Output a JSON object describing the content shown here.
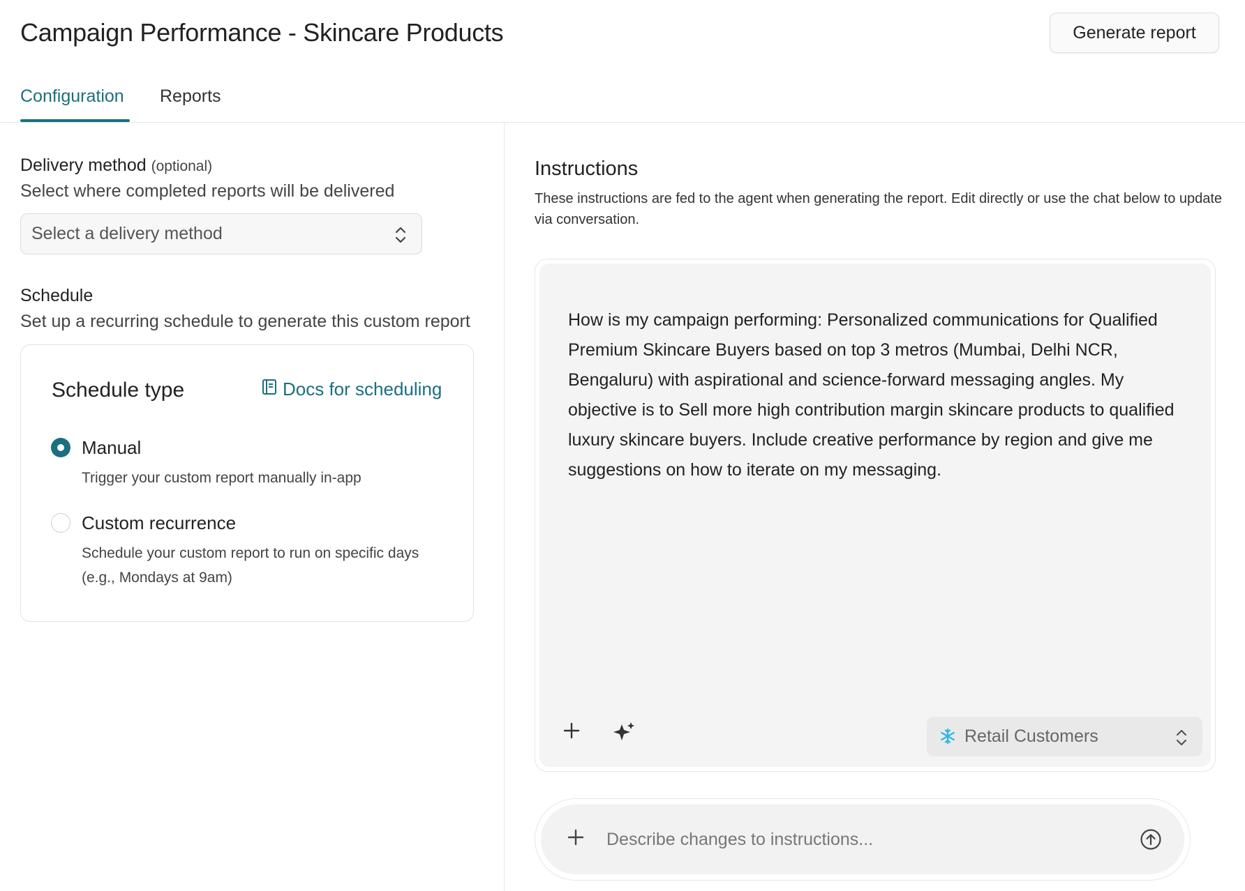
{
  "header": {
    "title": "Campaign Performance - Skincare Products",
    "generate_button": "Generate report"
  },
  "tabs": [
    {
      "label": "Configuration",
      "active": true
    },
    {
      "label": "Reports",
      "active": false
    }
  ],
  "delivery": {
    "label": "Delivery method",
    "optional": "(optional)",
    "description": "Select where completed reports will be delivered",
    "select_placeholder": "Select a delivery method"
  },
  "schedule": {
    "label": "Schedule",
    "description": "Set up a recurring schedule to generate this custom report",
    "card_title": "Schedule type",
    "docs_link": "Docs for scheduling",
    "options": [
      {
        "label": "Manual",
        "description": "Trigger your custom report manually in-app",
        "selected": true
      },
      {
        "label": "Custom recurrence",
        "description_line1": "Schedule your custom report to run on specific days",
        "description_line2": "(e.g., Mondays at 9am)",
        "selected": false
      }
    ]
  },
  "instructions": {
    "title": "Instructions",
    "description": "These instructions are fed to the agent when generating the report. Edit directly or use the chat below to update via conversation.",
    "text": "How is my campaign performing: Personalized communications for Qualified Premium Skincare Buyers based on top 3 metros (Mumbai, Delhi NCR, Bengaluru) with aspirational and science-forward messaging angles. My objective is to Sell more high contribution margin skincare products to qualified luxury skincare buyers. Include creative performance by region and give me suggestions on how to iterate on my messaging.",
    "data_source": "Retail Customers"
  },
  "chat": {
    "placeholder": "Describe changes to instructions..."
  },
  "colors": {
    "accent": "#1a6f80",
    "snowflake": "#29b5e8"
  },
  "icons": [
    "chevron-updown-icon",
    "book-icon",
    "plus-icon",
    "sparkle-icon",
    "snowflake-icon",
    "arrow-up-circle-icon"
  ]
}
